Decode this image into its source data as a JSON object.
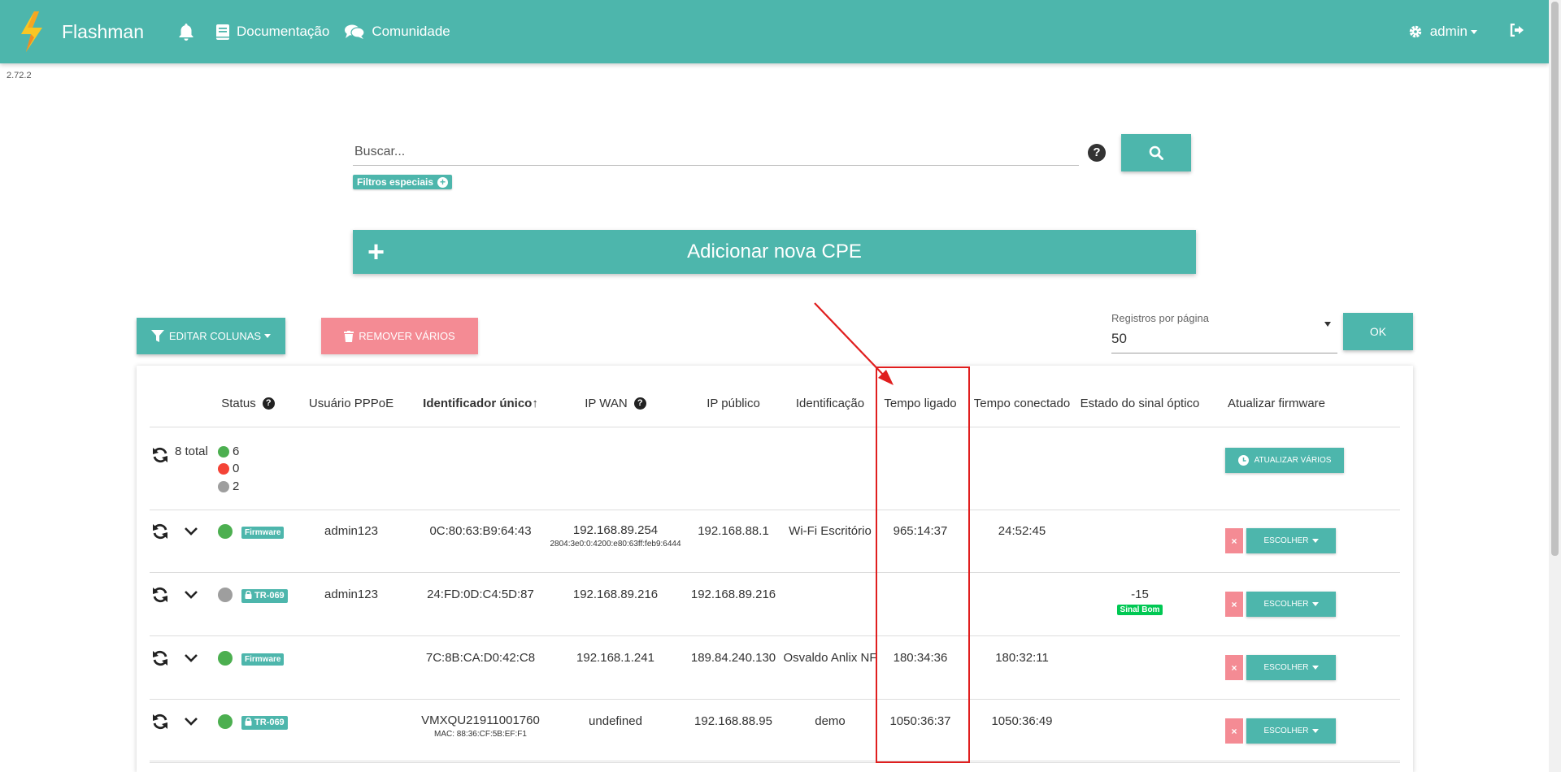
{
  "navbar": {
    "brand": "Flashman",
    "docs_label": "Documentação",
    "community_label": "Comunidade",
    "admin_label": "admin"
  },
  "version": "2.72.2",
  "search": {
    "placeholder": "Buscar...",
    "filter_chip": "Filtros especiais"
  },
  "add_cpe_label": "Adicionar nova CPE",
  "toolbar": {
    "edit_columns": "EDITAR COLUNAS",
    "remove_many": "REMOVER VÁRIOS",
    "per_page_label": "Registros por página",
    "per_page_value": "50",
    "ok_label": "OK"
  },
  "table": {
    "headers": {
      "status": "Status",
      "pppoe": "Usuário PPPoE",
      "uid": "Identificador único↑",
      "wan": "IP WAN",
      "public_ip": "IP público",
      "ident": "Identificação",
      "uptime": "Tempo ligado",
      "connected": "Tempo conectado",
      "optical": "Estado do sinal óptico",
      "firmware": "Atualizar firmware"
    },
    "summary": {
      "total": "8 total",
      "online": "6",
      "offline": "0",
      "unknown": "2",
      "update_many": "ATUALIZAR VÁRIOS"
    },
    "choose_label": "ESCOLHER",
    "x_label": "×",
    "rows": [
      {
        "badge": "Firmware",
        "pppoe": "admin123",
        "uid": "0C:80:63:B9:64:43",
        "uid_sub": "",
        "wan": "192.168.89.254",
        "wan_sub": "2804:3e0:0:4200:e80:63ff:feb9:6444",
        "public_ip": "192.168.88.1",
        "ident": "Wi-Fi Escritório",
        "uptime": "965:14:37",
        "connected": "24:52:45",
        "optical": "",
        "optical_badge": ""
      },
      {
        "badge": "TR-069",
        "pppoe": "admin123",
        "uid": "24:FD:0D:C4:5D:87",
        "uid_sub": "",
        "wan": "192.168.89.216",
        "wan_sub": "",
        "public_ip": "192.168.89.216",
        "ident": "",
        "uptime": "",
        "connected": "",
        "optical": "-15",
        "optical_badge": "Sinal Bom"
      },
      {
        "badge": "Firmware",
        "pppoe": "",
        "uid": "7C:8B:CA:D0:42:C8",
        "uid_sub": "",
        "wan": "192.168.1.241",
        "wan_sub": "",
        "public_ip": "189.84.240.130",
        "ident": "Osvaldo Anlix NF",
        "uptime": "180:34:36",
        "connected": "180:32:11",
        "optical": "",
        "optical_badge": ""
      },
      {
        "badge": "TR-069",
        "pppoe": "",
        "uid": "VMXQU21911001760",
        "uid_sub": "MAC: 88:36:CF:5B:EF:F1",
        "wan": "undefined",
        "wan_sub": "",
        "public_ip": "192.168.88.95",
        "ident": "demo",
        "uptime": "1050:36:37",
        "connected": "1050:36:49",
        "optical": "",
        "optical_badge": ""
      }
    ]
  },
  "colors": {
    "primary": "#4db6ac",
    "danger": "#f48b94",
    "online": "#4caf50",
    "offline": "#f44336",
    "unknown": "#9e9e9e",
    "annotation": "#e01e1e"
  }
}
